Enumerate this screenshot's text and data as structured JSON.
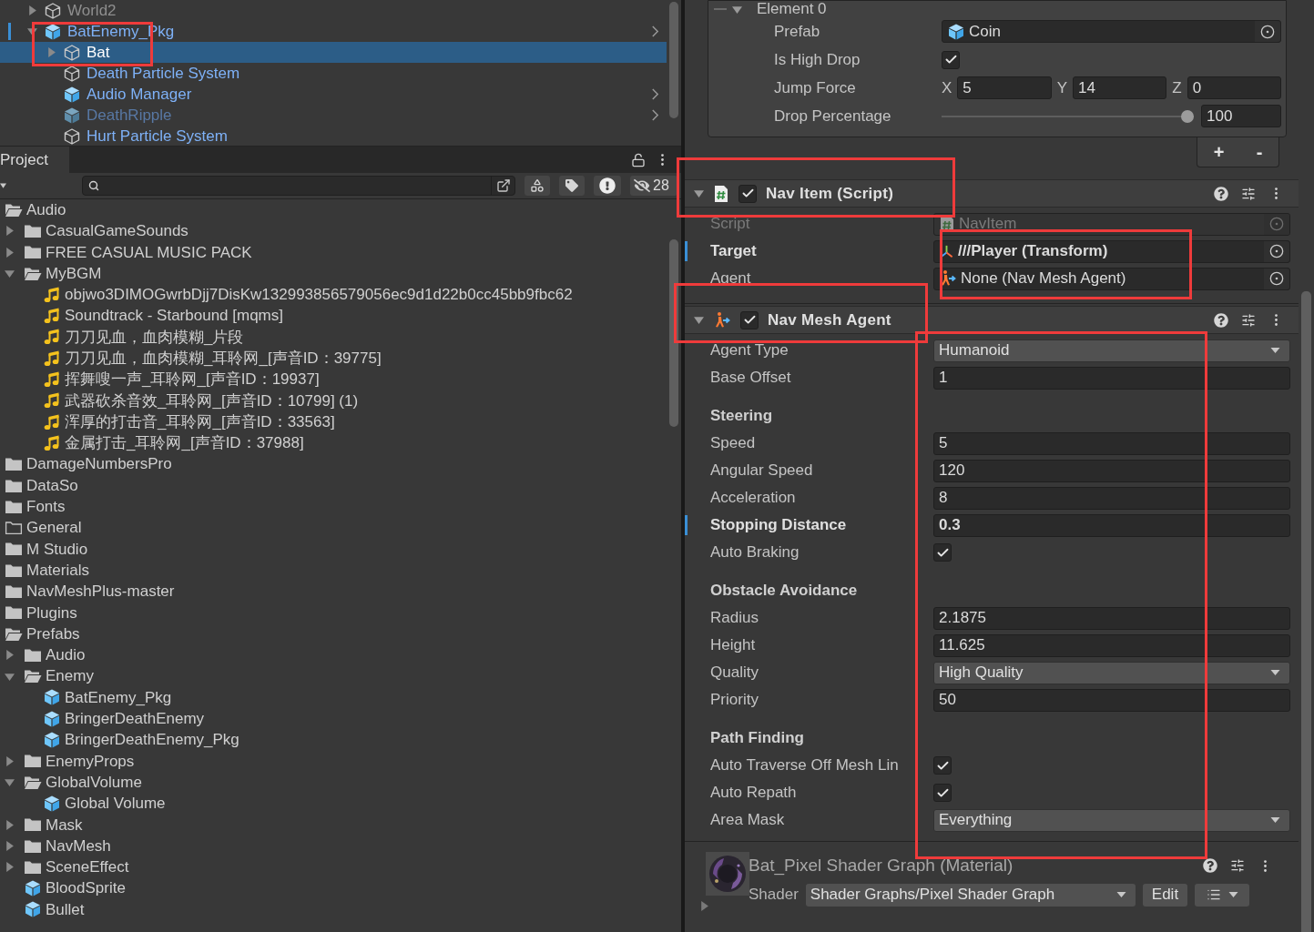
{
  "hierarchy": {
    "items": [
      {
        "name": "World2",
        "kind": "object",
        "expanded": false,
        "selected": false,
        "prefab_part": false,
        "disabled": false,
        "open_prefab": false,
        "modified": false
      },
      {
        "name": "BatEnemy_Pkg",
        "kind": "prefab",
        "expanded": true,
        "selected": false,
        "prefab_part": true,
        "disabled": false,
        "open_prefab": true,
        "modified": true,
        "children": [
          {
            "name": "Bat",
            "kind": "object",
            "expanded": false,
            "selected": true,
            "prefab_part": true,
            "disabled": false,
            "open_prefab": false,
            "modified": false
          },
          {
            "name": "Death Particle System",
            "kind": "object",
            "selected": false,
            "prefab_part": true,
            "disabled": false,
            "open_prefab": false,
            "modified": false
          },
          {
            "name": "Audio Manager",
            "kind": "prefab",
            "selected": false,
            "prefab_part": true,
            "disabled": false,
            "open_prefab": true,
            "modified": false
          },
          {
            "name": "DeathRipple",
            "kind": "prefab",
            "selected": false,
            "prefab_part": true,
            "disabled": true,
            "open_prefab": true,
            "modified": false
          },
          {
            "name": "Hurt Particle System",
            "kind": "object",
            "selected": false,
            "prefab_part": true,
            "disabled": false,
            "open_prefab": false,
            "modified": false
          }
        ]
      }
    ]
  },
  "project": {
    "tab": {
      "label": "Project",
      "selected": true
    },
    "hidden_count": "28",
    "items": [
      {
        "name": "Audio",
        "kind": "folder",
        "expanded": true,
        "children": [
          {
            "name": "CasualGameSounds",
            "kind": "folder",
            "expanded": false
          },
          {
            "name": "FREE CASUAL MUSIC PACK",
            "kind": "folder",
            "expanded": false
          },
          {
            "name": "MyBGM",
            "kind": "folder",
            "expanded": true,
            "children": [
              {
                "name": "objwo3DIMOGwrbDjj7DisKw132993856579056ec9d1d22b0cc45bb9fbc62",
                "kind": "audio"
              },
              {
                "name": "Soundtrack - Starbound [mqms]",
                "kind": "audio"
              },
              {
                "name": "刀刀见血，血肉模糊_片段",
                "kind": "audio"
              },
              {
                "name": "刀刀见血，血肉模糊_耳聆网_[声音ID：39775]",
                "kind": "audio"
              },
              {
                "name": "挥舞嗖一声_耳聆网_[声音ID：19937]",
                "kind": "audio"
              },
              {
                "name": "武器砍杀音效_耳聆网_[声音ID：10799] (1)",
                "kind": "audio"
              },
              {
                "name": "浑厚的打击音_耳聆网_[声音ID：33563]",
                "kind": "audio"
              },
              {
                "name": "金属打击_耳聆网_[声音ID：37988]",
                "kind": "audio"
              }
            ]
          }
        ]
      },
      {
        "name": "DamageNumbersPro",
        "kind": "folder",
        "expanded": false
      },
      {
        "name": "DataSo",
        "kind": "folder",
        "expanded": false
      },
      {
        "name": "Fonts",
        "kind": "folder",
        "expanded": false
      },
      {
        "name": "General",
        "kind": "empty-folder"
      },
      {
        "name": "M Studio",
        "kind": "folder",
        "expanded": false
      },
      {
        "name": "Materials",
        "kind": "folder",
        "expanded": false
      },
      {
        "name": "NavMeshPlus-master",
        "kind": "folder",
        "expanded": false
      },
      {
        "name": "Plugins",
        "kind": "folder",
        "expanded": false
      },
      {
        "name": "Prefabs",
        "kind": "folder",
        "expanded": true,
        "children": [
          {
            "name": "Audio",
            "kind": "folder",
            "expanded": false
          },
          {
            "name": "Enemy",
            "kind": "folder",
            "expanded": true,
            "children": [
              {
                "name": "BatEnemy_Pkg",
                "kind": "prefab"
              },
              {
                "name": "BringerDeathEnemy",
                "kind": "prefab"
              },
              {
                "name": "BringerDeathEnemy_Pkg",
                "kind": "prefab"
              }
            ]
          },
          {
            "name": "EnemyProps",
            "kind": "folder",
            "expanded": false
          },
          {
            "name": "GlobalVolume",
            "kind": "folder",
            "expanded": true,
            "children": [
              {
                "name": "Global Volume",
                "kind": "prefab"
              }
            ]
          },
          {
            "name": "Mask",
            "kind": "folder",
            "expanded": false
          },
          {
            "name": "NavMesh",
            "kind": "folder",
            "expanded": false
          },
          {
            "name": "SceneEffect",
            "kind": "folder",
            "expanded": false
          },
          {
            "name": "BloodSprite",
            "kind": "prefab"
          },
          {
            "name": "Bullet",
            "kind": "prefab"
          }
        ]
      }
    ]
  },
  "inspector": {
    "element": {
      "title": "Element 0",
      "expanded": true,
      "rows": [
        {
          "kind": "object",
          "label": "Prefab",
          "value": "Coin"
        },
        {
          "kind": "checkbox",
          "label": "Is High Drop",
          "checked": true
        },
        {
          "kind": "vector3",
          "label": "Jump Force",
          "axes": [
            {
              "axis": "X",
              "value": "5"
            },
            {
              "axis": "Y",
              "value": "14"
            },
            {
              "axis": "Z",
              "value": "0"
            }
          ]
        },
        {
          "kind": "slider",
          "label": "Drop Percentage",
          "level": 1,
          "value": "100"
        }
      ],
      "list_buttons": [
        "+",
        "-"
      ]
    },
    "components": [
      {
        "title": "Nav Item (Script)",
        "enabled": true,
        "expanded": true,
        "rows": [
          {
            "kind": "object",
            "label": "Script",
            "value": "NavItem",
            "disabled": true,
            "modified": false
          },
          {
            "kind": "object",
            "label": "Target",
            "value": "///Player (Transform)",
            "disabled": false,
            "modified": true
          },
          {
            "kind": "object",
            "label": "Agent",
            "value": "None (Nav Mesh Agent)",
            "disabled": false,
            "modified": false
          }
        ]
      },
      {
        "title": "Nav Mesh Agent",
        "enabled": true,
        "expanded": true,
        "rows": [
          {
            "kind": "dropdown",
            "label": "Agent Type",
            "value": "Humanoid"
          },
          {
            "kind": "number",
            "label": "Base Offset",
            "value": "1",
            "modified": false
          },
          {
            "kind": "header",
            "label": "Steering"
          },
          {
            "kind": "number",
            "label": "Speed",
            "value": "5",
            "modified": false
          },
          {
            "kind": "number",
            "label": "Angular Speed",
            "value": "120",
            "modified": false
          },
          {
            "kind": "number",
            "label": "Acceleration",
            "value": "8",
            "modified": false
          },
          {
            "kind": "number",
            "label": "Stopping Distance",
            "value": "0.3",
            "modified": true
          },
          {
            "kind": "checkbox",
            "label": "Auto Braking",
            "checked": true
          },
          {
            "kind": "header",
            "label": "Obstacle Avoidance"
          },
          {
            "kind": "number",
            "label": "Radius",
            "value": "2.1875",
            "modified": false
          },
          {
            "kind": "number",
            "label": "Height",
            "value": "11.625",
            "modified": false
          },
          {
            "kind": "dropdown",
            "label": "Quality",
            "value": "High Quality"
          },
          {
            "kind": "number",
            "label": "Priority",
            "value": "50",
            "modified": false
          },
          {
            "kind": "header",
            "label": "Path Finding"
          },
          {
            "kind": "checkbox",
            "label": "Auto Traverse Off Mesh Lin",
            "checked": true
          },
          {
            "kind": "checkbox",
            "label": "Auto Repath",
            "checked": true
          },
          {
            "kind": "dropdown",
            "label": "Area Mask",
            "value": "Everything"
          }
        ]
      }
    ],
    "material": {
      "title": "Bat_Pixel Shader Graph (Material)",
      "expanded": false,
      "shader_label": "Shader",
      "shader": "Shader Graphs/Pixel Shader Graph",
      "edit": "Edit"
    }
  }
}
